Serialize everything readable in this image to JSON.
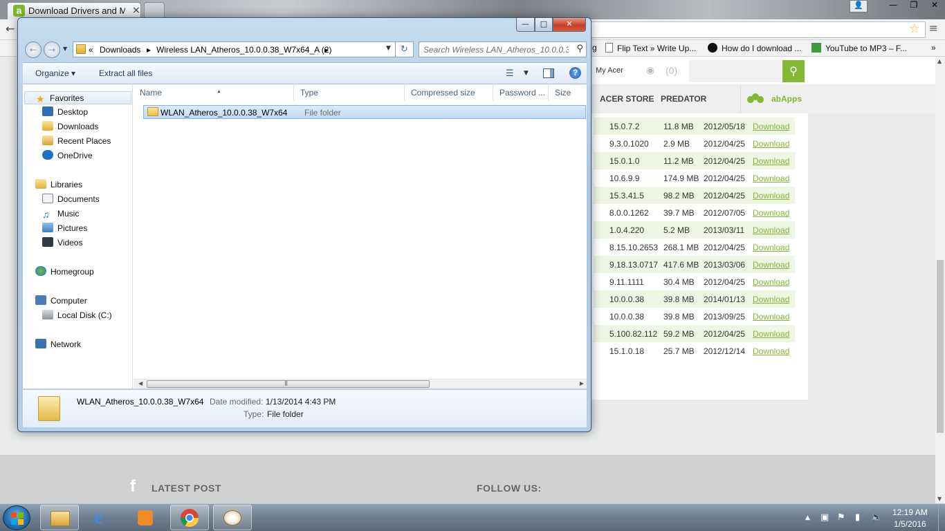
{
  "browser": {
    "tab_title": "Download Drivers and Ma",
    "tab_favicon_letter": "a",
    "tab_close": "×",
    "bookmarks": [
      {
        "label": "Flip Text » Write Up..."
      },
      {
        "label": "How do I download ..."
      },
      {
        "label": "YouTube to MP3 – F..."
      }
    ],
    "bookmark_partial": "g",
    "menu_glyph": "≡",
    "star_glyph": "☆",
    "back_glyph": "←",
    "bookmarks_more": "»"
  },
  "acer": {
    "my_acer": "My Acer",
    "cart_count": "(0)",
    "nav": [
      "ACER STORE",
      "PREDATOR"
    ],
    "abapps": "abApps",
    "download_label": "Download",
    "drivers": [
      {
        "version": "15.0.7.2",
        "size": "11.8 MB",
        "date": "2012/05/18"
      },
      {
        "version": "9.3.0.1020",
        "size": "2.9 MB",
        "date": "2012/04/25"
      },
      {
        "version": "15.0.1.0",
        "size": "11.2 MB",
        "date": "2012/04/25"
      },
      {
        "version": "10.6.9.9",
        "size": "174.9 MB",
        "date": "2012/04/25"
      },
      {
        "version": "15.3.41.5",
        "size": "98.2 MB",
        "date": "2012/04/25"
      },
      {
        "version": "8.0.0.1262",
        "size": "39.7 MB",
        "date": "2012/07/05"
      },
      {
        "version": "1.0.4.220",
        "size": "5.2 MB",
        "date": "2013/03/11"
      },
      {
        "version": "8.15.10.2653",
        "size": "268.1 MB",
        "date": "2012/04/25"
      },
      {
        "version": "9.18.13.0717",
        "size": "417.6 MB",
        "date": "2013/03/06"
      },
      {
        "version": "9.11.1111",
        "size": "30.4 MB",
        "date": "2012/04/25"
      },
      {
        "version": "10.0.0.38",
        "size": "39.8 MB",
        "date": "2014/01/13"
      },
      {
        "version": "10.0.0.38",
        "size": "39.8 MB",
        "date": "2013/09/25"
      },
      {
        "version": "5.100.82.112",
        "size": "59.2 MB",
        "date": "2012/04/25"
      },
      {
        "version": "15.1.0.18",
        "size": "25.7 MB",
        "date": "2012/12/14"
      }
    ],
    "footer_latest": "LATEST POST",
    "footer_follow": "FOLLOW US:",
    "facebook_glyph": "f"
  },
  "explorer": {
    "window_buttons": {
      "min": "—",
      "max": "□",
      "close": "✕"
    },
    "address": {
      "chevron": "«",
      "crumbs": [
        "Downloads",
        "Wireless LAN_Atheros_10.0.0.38_W7x64_A (2)"
      ],
      "separator": "▸"
    },
    "search_placeholder": "Search Wireless LAN_Atheros_10.0.0.3...",
    "toolbar": {
      "organize": "Organize ▾",
      "extract": "Extract all files",
      "help": "?"
    },
    "nav_tree": {
      "favorites_header": "Favorites",
      "favorites": [
        "Desktop",
        "Downloads",
        "Recent Places",
        "OneDrive"
      ],
      "libraries_header": "Libraries",
      "libraries": [
        "Documents",
        "Music",
        "Pictures",
        "Videos"
      ],
      "homegroup": "Homegroup",
      "computer": "Computer",
      "computer_items": [
        "Local Disk (C:)"
      ],
      "network": "Network"
    },
    "columns": [
      "Name",
      "Type",
      "Compressed size",
      "Password ...",
      "Size"
    ],
    "items": [
      {
        "name": "WLAN_Atheros_10.0.0.38_W7x64",
        "type": "File folder"
      }
    ],
    "details": {
      "name": "WLAN_Atheros_10.0.0.38_W7x64",
      "date_label": "Date modified:",
      "date_value": "1/13/2014 4:43 PM",
      "type_label": "Type:",
      "type_value": "File folder"
    }
  },
  "taskbar": {
    "time": "12:19 AM",
    "date": "1/5/2016"
  }
}
